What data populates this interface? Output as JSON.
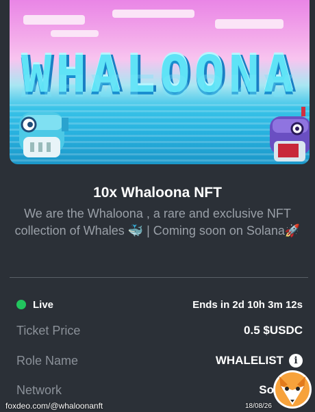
{
  "banner": {
    "logo_text": "WHALOONA",
    "colors": {
      "sky_top": "#e985e6",
      "sea": "#27b0de",
      "logo": "#5fe3f6"
    }
  },
  "nft": {
    "title": "10x Whaloona NFT",
    "description": "We are the Whaloona , a rare and exclusive NFT collection of Whales 🐳 | Coming soon on Solana🚀"
  },
  "status": {
    "live_label": "Live",
    "live_color": "#22c55e",
    "ends_text": "Ends in 2d 10h 3m 12s"
  },
  "details": [
    {
      "label": "Ticket Price",
      "value": "0.5 $USDC"
    },
    {
      "label": "Role Name",
      "value": "WHALELIST",
      "icon": "info-icon"
    },
    {
      "label": "Network",
      "value": "So"
    }
  ],
  "watermark": {
    "source": "foxdeo.com/@whaloonanft",
    "date": "18/08/26",
    "logo": "fox-logo-icon"
  }
}
